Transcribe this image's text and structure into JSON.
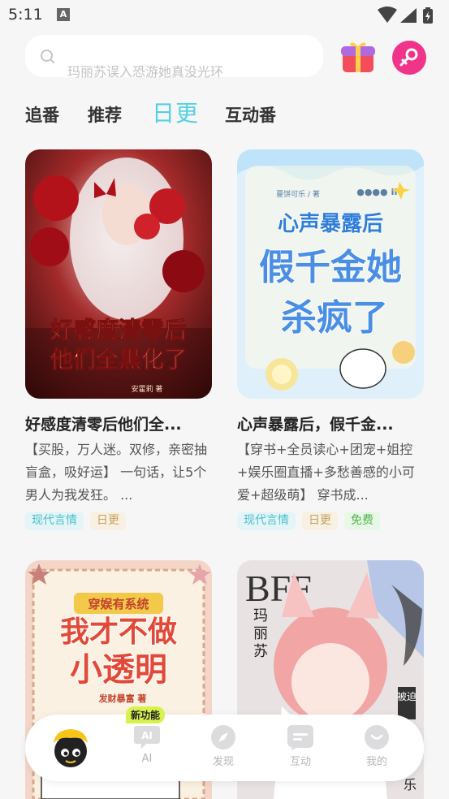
{
  "status_bar": {
    "time": "5:11",
    "notif_glyph": "A"
  },
  "search": {
    "placeholder": "玛丽苏误入恐游她真没光环"
  },
  "tabs": [
    {
      "label": "追番"
    },
    {
      "label": "推荐"
    },
    {
      "label": "日更",
      "active": true
    },
    {
      "label": "互动番"
    }
  ],
  "cards": [
    {
      "title": "好感度清零后他们全...",
      "desc": "【买股，万人迷。双修，亲密抽盲盒，吸好运】 一句话，让5个男人为我发狂。 ...",
      "cover_title_1": "好感度清零后",
      "cover_title_2": "他们全黑化了",
      "cover_author": "安霍莉 著",
      "tags": [
        "现代言情",
        "日更"
      ]
    },
    {
      "title": "心声暴露后，假千金...",
      "desc": "【穿书+全员读心+团宠+姐控+娱乐圈直播+多愁善感的小可爱+超级萌】 穿书成...",
      "cover_author": "蔓饼可乐 / 著",
      "cover_top": "●●●● IN",
      "cover_title_1": "心声暴露后",
      "cover_title_2": "假千金她",
      "cover_title_3": "杀疯了",
      "tags": [
        "现代言情",
        "日更",
        "免费"
      ]
    },
    {
      "cover_title_1": "穿娱有系统",
      "cover_title_2": "我才不做",
      "cover_title_3": "小透明",
      "cover_author": "发财暴富 著"
    },
    {
      "cover_title_1": "BFF",
      "cover_title_2": "玛",
      "cover_title_3": "丽",
      "cover_title_4": "苏",
      "cover_side": "被迫",
      "cover_side_2": "乐"
    }
  ],
  "bottom_nav": {
    "new_badge": "新功能",
    "items": [
      {
        "label": "AI",
        "icon": "ai-icon"
      },
      {
        "label": "发现",
        "icon": "discover-icon"
      },
      {
        "label": "互动",
        "icon": "interact-icon"
      },
      {
        "label": "我的",
        "icon": "me-icon"
      }
    ]
  },
  "colors": {
    "accent": "#52d1e3",
    "profile": "#f0348a",
    "gift": "#f34d5c",
    "badge": "#d8f24d"
  }
}
